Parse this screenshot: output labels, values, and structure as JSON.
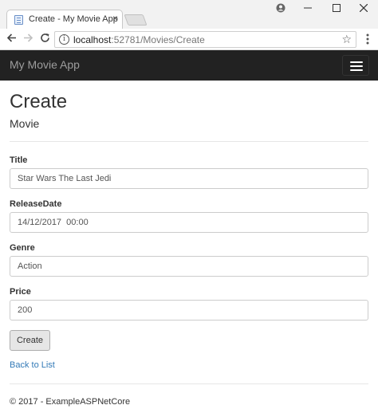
{
  "browser": {
    "tab_title": "Create - My Movie App",
    "tab_close": "×",
    "url_host": "localhost",
    "url_path": ":52781/Movies/Create"
  },
  "navbar": {
    "brand": "My Movie App"
  },
  "page": {
    "title": "Create",
    "subtitle": "Movie"
  },
  "form": {
    "title_label": "Title",
    "title_value": "Star Wars The Last Jedi",
    "release_label": "ReleaseDate",
    "release_value": "14/12/2017  00:00",
    "genre_label": "Genre",
    "genre_value": "Action",
    "price_label": "Price",
    "price_value": "200",
    "submit_label": "Create"
  },
  "links": {
    "back": "Back to List"
  },
  "footer": {
    "text": "© 2017 - ExampleASPNetCore"
  }
}
